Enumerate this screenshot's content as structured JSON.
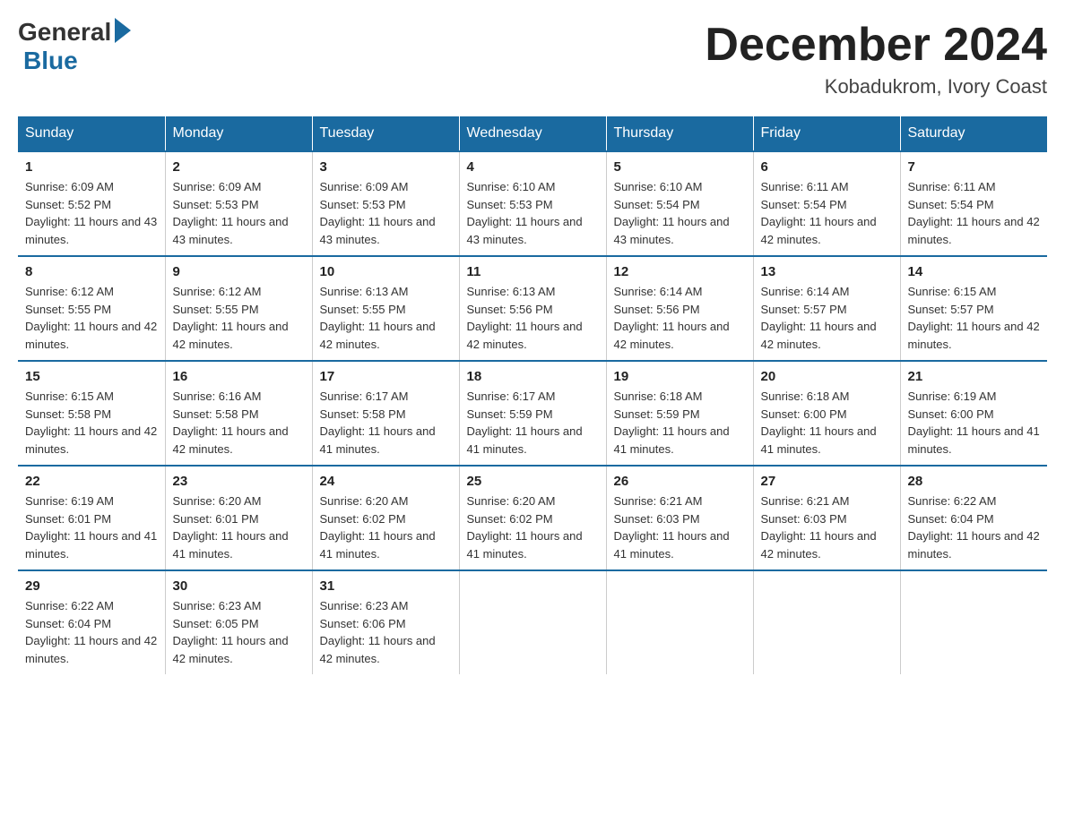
{
  "header": {
    "logo_general": "General",
    "logo_blue": "Blue",
    "month_title": "December 2024",
    "location": "Kobadukrom, Ivory Coast"
  },
  "weekdays": [
    "Sunday",
    "Monday",
    "Tuesday",
    "Wednesday",
    "Thursday",
    "Friday",
    "Saturday"
  ],
  "weeks": [
    [
      {
        "day": "1",
        "sunrise": "Sunrise: 6:09 AM",
        "sunset": "Sunset: 5:52 PM",
        "daylight": "Daylight: 11 hours and 43 minutes."
      },
      {
        "day": "2",
        "sunrise": "Sunrise: 6:09 AM",
        "sunset": "Sunset: 5:53 PM",
        "daylight": "Daylight: 11 hours and 43 minutes."
      },
      {
        "day": "3",
        "sunrise": "Sunrise: 6:09 AM",
        "sunset": "Sunset: 5:53 PM",
        "daylight": "Daylight: 11 hours and 43 minutes."
      },
      {
        "day": "4",
        "sunrise": "Sunrise: 6:10 AM",
        "sunset": "Sunset: 5:53 PM",
        "daylight": "Daylight: 11 hours and 43 minutes."
      },
      {
        "day": "5",
        "sunrise": "Sunrise: 6:10 AM",
        "sunset": "Sunset: 5:54 PM",
        "daylight": "Daylight: 11 hours and 43 minutes."
      },
      {
        "day": "6",
        "sunrise": "Sunrise: 6:11 AM",
        "sunset": "Sunset: 5:54 PM",
        "daylight": "Daylight: 11 hours and 42 minutes."
      },
      {
        "day": "7",
        "sunrise": "Sunrise: 6:11 AM",
        "sunset": "Sunset: 5:54 PM",
        "daylight": "Daylight: 11 hours and 42 minutes."
      }
    ],
    [
      {
        "day": "8",
        "sunrise": "Sunrise: 6:12 AM",
        "sunset": "Sunset: 5:55 PM",
        "daylight": "Daylight: 11 hours and 42 minutes."
      },
      {
        "day": "9",
        "sunrise": "Sunrise: 6:12 AM",
        "sunset": "Sunset: 5:55 PM",
        "daylight": "Daylight: 11 hours and 42 minutes."
      },
      {
        "day": "10",
        "sunrise": "Sunrise: 6:13 AM",
        "sunset": "Sunset: 5:55 PM",
        "daylight": "Daylight: 11 hours and 42 minutes."
      },
      {
        "day": "11",
        "sunrise": "Sunrise: 6:13 AM",
        "sunset": "Sunset: 5:56 PM",
        "daylight": "Daylight: 11 hours and 42 minutes."
      },
      {
        "day": "12",
        "sunrise": "Sunrise: 6:14 AM",
        "sunset": "Sunset: 5:56 PM",
        "daylight": "Daylight: 11 hours and 42 minutes."
      },
      {
        "day": "13",
        "sunrise": "Sunrise: 6:14 AM",
        "sunset": "Sunset: 5:57 PM",
        "daylight": "Daylight: 11 hours and 42 minutes."
      },
      {
        "day": "14",
        "sunrise": "Sunrise: 6:15 AM",
        "sunset": "Sunset: 5:57 PM",
        "daylight": "Daylight: 11 hours and 42 minutes."
      }
    ],
    [
      {
        "day": "15",
        "sunrise": "Sunrise: 6:15 AM",
        "sunset": "Sunset: 5:58 PM",
        "daylight": "Daylight: 11 hours and 42 minutes."
      },
      {
        "day": "16",
        "sunrise": "Sunrise: 6:16 AM",
        "sunset": "Sunset: 5:58 PM",
        "daylight": "Daylight: 11 hours and 42 minutes."
      },
      {
        "day": "17",
        "sunrise": "Sunrise: 6:17 AM",
        "sunset": "Sunset: 5:58 PM",
        "daylight": "Daylight: 11 hours and 41 minutes."
      },
      {
        "day": "18",
        "sunrise": "Sunrise: 6:17 AM",
        "sunset": "Sunset: 5:59 PM",
        "daylight": "Daylight: 11 hours and 41 minutes."
      },
      {
        "day": "19",
        "sunrise": "Sunrise: 6:18 AM",
        "sunset": "Sunset: 5:59 PM",
        "daylight": "Daylight: 11 hours and 41 minutes."
      },
      {
        "day": "20",
        "sunrise": "Sunrise: 6:18 AM",
        "sunset": "Sunset: 6:00 PM",
        "daylight": "Daylight: 11 hours and 41 minutes."
      },
      {
        "day": "21",
        "sunrise": "Sunrise: 6:19 AM",
        "sunset": "Sunset: 6:00 PM",
        "daylight": "Daylight: 11 hours and 41 minutes."
      }
    ],
    [
      {
        "day": "22",
        "sunrise": "Sunrise: 6:19 AM",
        "sunset": "Sunset: 6:01 PM",
        "daylight": "Daylight: 11 hours and 41 minutes."
      },
      {
        "day": "23",
        "sunrise": "Sunrise: 6:20 AM",
        "sunset": "Sunset: 6:01 PM",
        "daylight": "Daylight: 11 hours and 41 minutes."
      },
      {
        "day": "24",
        "sunrise": "Sunrise: 6:20 AM",
        "sunset": "Sunset: 6:02 PM",
        "daylight": "Daylight: 11 hours and 41 minutes."
      },
      {
        "day": "25",
        "sunrise": "Sunrise: 6:20 AM",
        "sunset": "Sunset: 6:02 PM",
        "daylight": "Daylight: 11 hours and 41 minutes."
      },
      {
        "day": "26",
        "sunrise": "Sunrise: 6:21 AM",
        "sunset": "Sunset: 6:03 PM",
        "daylight": "Daylight: 11 hours and 41 minutes."
      },
      {
        "day": "27",
        "sunrise": "Sunrise: 6:21 AM",
        "sunset": "Sunset: 6:03 PM",
        "daylight": "Daylight: 11 hours and 42 minutes."
      },
      {
        "day": "28",
        "sunrise": "Sunrise: 6:22 AM",
        "sunset": "Sunset: 6:04 PM",
        "daylight": "Daylight: 11 hours and 42 minutes."
      }
    ],
    [
      {
        "day": "29",
        "sunrise": "Sunrise: 6:22 AM",
        "sunset": "Sunset: 6:04 PM",
        "daylight": "Daylight: 11 hours and 42 minutes."
      },
      {
        "day": "30",
        "sunrise": "Sunrise: 6:23 AM",
        "sunset": "Sunset: 6:05 PM",
        "daylight": "Daylight: 11 hours and 42 minutes."
      },
      {
        "day": "31",
        "sunrise": "Sunrise: 6:23 AM",
        "sunset": "Sunset: 6:06 PM",
        "daylight": "Daylight: 11 hours and 42 minutes."
      },
      {
        "day": "",
        "sunrise": "",
        "sunset": "",
        "daylight": ""
      },
      {
        "day": "",
        "sunrise": "",
        "sunset": "",
        "daylight": ""
      },
      {
        "day": "",
        "sunrise": "",
        "sunset": "",
        "daylight": ""
      },
      {
        "day": "",
        "sunrise": "",
        "sunset": "",
        "daylight": ""
      }
    ]
  ]
}
